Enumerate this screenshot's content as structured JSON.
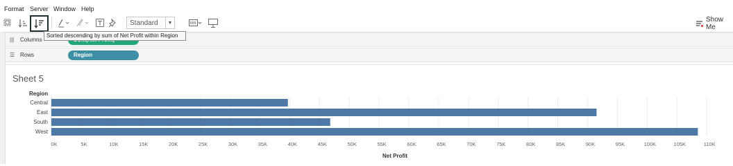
{
  "menu": {
    "items": [
      "Format",
      "Server",
      "Window",
      "Help"
    ]
  },
  "toolbar": {
    "icons": [
      "swap-icon",
      "sort-ascending-icon",
      "sort-descending-icon",
      "highlight-icon",
      "annotate-icon",
      "text-label-icon",
      "pin-icon",
      "fit-icon",
      "presentation-icon"
    ],
    "fit_value": "Standard",
    "show_me_label": "Show Me"
  },
  "tooltip": {
    "text": "Sorted descending by sum of Net Profit within Region"
  },
  "shelves": {
    "columns_label": "Columns",
    "columns_pill": "SUM(Net Profit)",
    "rows_label": "Rows",
    "rows_pill": "Region"
  },
  "sheet": {
    "title": "Sheet 5",
    "row_header": "Region"
  },
  "colors": {
    "bar": "#4e79a7",
    "green_pill": "#22a77a",
    "blue_pill": "#3d8fa5"
  },
  "chart_data": {
    "type": "bar",
    "orientation": "horizontal",
    "categories": [
      "Central",
      "East",
      "South",
      "West"
    ],
    "values": [
      39700,
      91500,
      46800,
      108500
    ],
    "xlabel": "Net Profit",
    "ylabel": "Region",
    "xlim": [
      0,
      113000
    ],
    "ticks": [
      0,
      5000,
      10000,
      15000,
      20000,
      25000,
      30000,
      35000,
      40000,
      45000,
      50000,
      55000,
      60000,
      65000,
      70000,
      75000,
      80000,
      85000,
      90000,
      95000,
      100000,
      105000,
      110000
    ],
    "tick_labels": [
      "0K",
      "5K",
      "10K",
      "15K",
      "20K",
      "25K",
      "30K",
      "35K",
      "40K",
      "45K",
      "50K",
      "55K",
      "60K",
      "65K",
      "70K",
      "75K",
      "80K",
      "85K",
      "90K",
      "95K",
      "100K",
      "105K",
      "110K"
    ],
    "grid": true
  }
}
